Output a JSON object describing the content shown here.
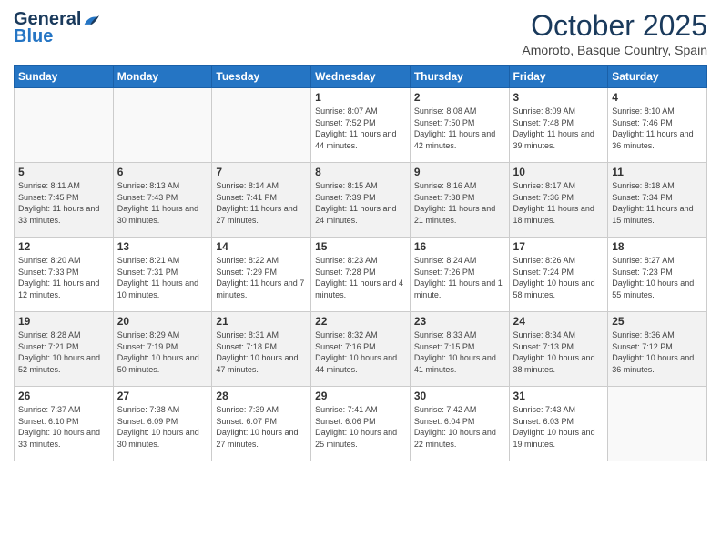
{
  "logo": {
    "general": "General",
    "blue": "Blue"
  },
  "title": "October 2025",
  "location": "Amoroto, Basque Country, Spain",
  "days_of_week": [
    "Sunday",
    "Monday",
    "Tuesday",
    "Wednesday",
    "Thursday",
    "Friday",
    "Saturday"
  ],
  "weeks": [
    [
      {
        "day": "",
        "info": ""
      },
      {
        "day": "",
        "info": ""
      },
      {
        "day": "",
        "info": ""
      },
      {
        "day": "1",
        "info": "Sunrise: 8:07 AM\nSunset: 7:52 PM\nDaylight: 11 hours and 44 minutes."
      },
      {
        "day": "2",
        "info": "Sunrise: 8:08 AM\nSunset: 7:50 PM\nDaylight: 11 hours and 42 minutes."
      },
      {
        "day": "3",
        "info": "Sunrise: 8:09 AM\nSunset: 7:48 PM\nDaylight: 11 hours and 39 minutes."
      },
      {
        "day": "4",
        "info": "Sunrise: 8:10 AM\nSunset: 7:46 PM\nDaylight: 11 hours and 36 minutes."
      }
    ],
    [
      {
        "day": "5",
        "info": "Sunrise: 8:11 AM\nSunset: 7:45 PM\nDaylight: 11 hours and 33 minutes."
      },
      {
        "day": "6",
        "info": "Sunrise: 8:13 AM\nSunset: 7:43 PM\nDaylight: 11 hours and 30 minutes."
      },
      {
        "day": "7",
        "info": "Sunrise: 8:14 AM\nSunset: 7:41 PM\nDaylight: 11 hours and 27 minutes."
      },
      {
        "day": "8",
        "info": "Sunrise: 8:15 AM\nSunset: 7:39 PM\nDaylight: 11 hours and 24 minutes."
      },
      {
        "day": "9",
        "info": "Sunrise: 8:16 AM\nSunset: 7:38 PM\nDaylight: 11 hours and 21 minutes."
      },
      {
        "day": "10",
        "info": "Sunrise: 8:17 AM\nSunset: 7:36 PM\nDaylight: 11 hours and 18 minutes."
      },
      {
        "day": "11",
        "info": "Sunrise: 8:18 AM\nSunset: 7:34 PM\nDaylight: 11 hours and 15 minutes."
      }
    ],
    [
      {
        "day": "12",
        "info": "Sunrise: 8:20 AM\nSunset: 7:33 PM\nDaylight: 11 hours and 12 minutes."
      },
      {
        "day": "13",
        "info": "Sunrise: 8:21 AM\nSunset: 7:31 PM\nDaylight: 11 hours and 10 minutes."
      },
      {
        "day": "14",
        "info": "Sunrise: 8:22 AM\nSunset: 7:29 PM\nDaylight: 11 hours and 7 minutes."
      },
      {
        "day": "15",
        "info": "Sunrise: 8:23 AM\nSunset: 7:28 PM\nDaylight: 11 hours and 4 minutes."
      },
      {
        "day": "16",
        "info": "Sunrise: 8:24 AM\nSunset: 7:26 PM\nDaylight: 11 hours and 1 minute."
      },
      {
        "day": "17",
        "info": "Sunrise: 8:26 AM\nSunset: 7:24 PM\nDaylight: 10 hours and 58 minutes."
      },
      {
        "day": "18",
        "info": "Sunrise: 8:27 AM\nSunset: 7:23 PM\nDaylight: 10 hours and 55 minutes."
      }
    ],
    [
      {
        "day": "19",
        "info": "Sunrise: 8:28 AM\nSunset: 7:21 PM\nDaylight: 10 hours and 52 minutes."
      },
      {
        "day": "20",
        "info": "Sunrise: 8:29 AM\nSunset: 7:19 PM\nDaylight: 10 hours and 50 minutes."
      },
      {
        "day": "21",
        "info": "Sunrise: 8:31 AM\nSunset: 7:18 PM\nDaylight: 10 hours and 47 minutes."
      },
      {
        "day": "22",
        "info": "Sunrise: 8:32 AM\nSunset: 7:16 PM\nDaylight: 10 hours and 44 minutes."
      },
      {
        "day": "23",
        "info": "Sunrise: 8:33 AM\nSunset: 7:15 PM\nDaylight: 10 hours and 41 minutes."
      },
      {
        "day": "24",
        "info": "Sunrise: 8:34 AM\nSunset: 7:13 PM\nDaylight: 10 hours and 38 minutes."
      },
      {
        "day": "25",
        "info": "Sunrise: 8:36 AM\nSunset: 7:12 PM\nDaylight: 10 hours and 36 minutes."
      }
    ],
    [
      {
        "day": "26",
        "info": "Sunrise: 7:37 AM\nSunset: 6:10 PM\nDaylight: 10 hours and 33 minutes."
      },
      {
        "day": "27",
        "info": "Sunrise: 7:38 AM\nSunset: 6:09 PM\nDaylight: 10 hours and 30 minutes."
      },
      {
        "day": "28",
        "info": "Sunrise: 7:39 AM\nSunset: 6:07 PM\nDaylight: 10 hours and 27 minutes."
      },
      {
        "day": "29",
        "info": "Sunrise: 7:41 AM\nSunset: 6:06 PM\nDaylight: 10 hours and 25 minutes."
      },
      {
        "day": "30",
        "info": "Sunrise: 7:42 AM\nSunset: 6:04 PM\nDaylight: 10 hours and 22 minutes."
      },
      {
        "day": "31",
        "info": "Sunrise: 7:43 AM\nSunset: 6:03 PM\nDaylight: 10 hours and 19 minutes."
      },
      {
        "day": "",
        "info": ""
      }
    ]
  ]
}
